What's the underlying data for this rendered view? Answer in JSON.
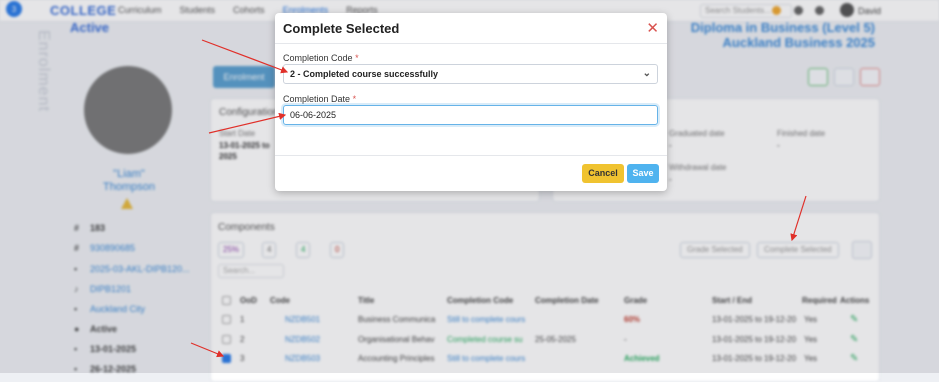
{
  "app": {
    "brand": "COLLEGE",
    "notif_count": "3"
  },
  "nav": [
    "Curriculum",
    "Students",
    "Cohorts",
    "Enrolments",
    "Reports"
  ],
  "header": {
    "search_placeholder": "Search Students...",
    "user": "David"
  },
  "page": {
    "status": "Active",
    "sidebar_title": "Enrolment",
    "title_line1": "Diploma in Business (Level 5)",
    "title_line2": "Auckland Business 2025",
    "tab": "Enrolment"
  },
  "student": {
    "name_line1": "\"Liam\"",
    "name_line2": "Thompson",
    "id": "183",
    "number": "930890685",
    "cohort": "2025-03-AKL-DIPB120...",
    "programme": "DIPB1201",
    "campus": "Auckland City",
    "status": "Active",
    "start": "13-01-2025",
    "end": "26-12-2025"
  },
  "config": {
    "title": "Configuration",
    "start_label": "Start Date",
    "start_value": "13-01-2025 to",
    "start_value2": "2025",
    "graduated_label": "Graduated date",
    "graduated_value": "-",
    "finished_label": "Finished date",
    "finished_value": "-",
    "withdrawal_label": "Withdrawal date",
    "withdrawal_value": "-"
  },
  "components": {
    "title": "Components",
    "pills": [
      "25%",
      "4",
      "4",
      "0"
    ],
    "grade_btn": "Grade Selected",
    "complete_btn": "Complete Selected",
    "search_placeholder": "Search...",
    "columns": [
      "OoD",
      "Code",
      "Title",
      "Completion Code",
      "Completion Date",
      "Grade",
      "Start / End",
      "Required",
      "Actions"
    ],
    "rows": [
      {
        "ood": "1",
        "code": "NZDB501",
        "title": "Business Communica",
        "comp_code": "Still to complete cours",
        "comp_date": "",
        "grade": "60%",
        "startend": "13-01-2025 to 19-12-20",
        "req": "Yes"
      },
      {
        "ood": "2",
        "code": "NZDB502",
        "title": "Organisational Behav",
        "comp_code": "Completed course su",
        "comp_date": "25-05-2025",
        "grade": "-",
        "startend": "13-01-2025 to 19-12-20",
        "req": "Yes"
      },
      {
        "ood": "3",
        "code": "NZDB503",
        "title": "Accounting Principles",
        "comp_code": "Still to complete cours",
        "comp_date": "",
        "grade": "Achieved",
        "startend": "13-01-2025 to 19-12-20",
        "req": "Yes"
      }
    ]
  },
  "modal": {
    "title": "Complete Selected",
    "code_label": "Completion Code",
    "code_value": "2 - Completed course successfully",
    "date_label": "Completion Date",
    "date_value": "06-06-2025",
    "cancel": "Cancel",
    "save": "Save",
    "required_mark": "*"
  }
}
